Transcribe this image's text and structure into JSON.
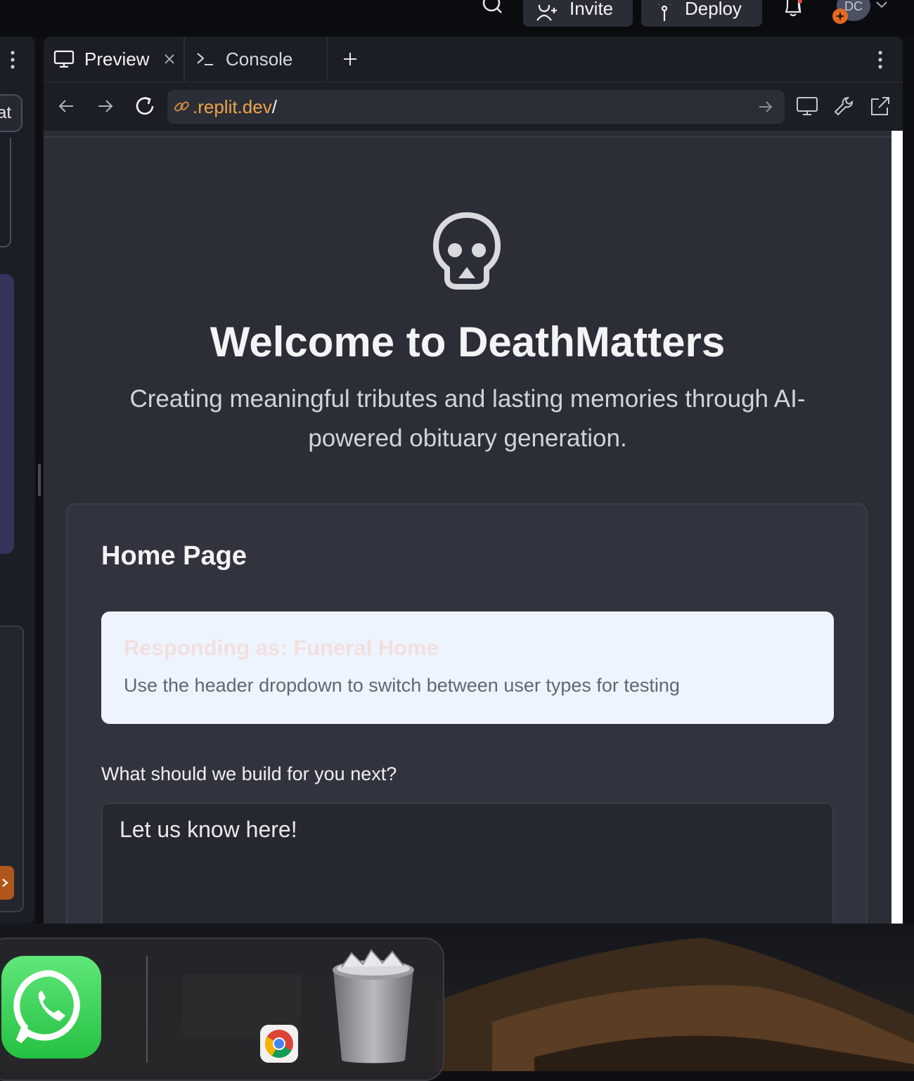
{
  "topbar": {
    "invite_label": "Invite",
    "deploy_label": "Deploy",
    "avatar_initials": "DC"
  },
  "left_panel": {
    "chat_partial": "at"
  },
  "tabs": [
    {
      "label": "Preview",
      "icon": "monitor-icon"
    },
    {
      "label": "Console",
      "icon": "terminal-icon"
    }
  ],
  "url": {
    "value_highlight": ".replit.dev",
    "value_suffix": "/"
  },
  "page": {
    "logo_icon": "skull-icon",
    "title": "Welcome to DeathMatters",
    "subtitle": "Creating meaningful tributes and lasting memories through AI-powered obituary generation.",
    "card": {
      "heading": "Home Page",
      "notice_title": "Responding as: Funeral Home",
      "notice_body": "Use the header dropdown to switch between user types for testing",
      "question_label": "What should we build for you next?",
      "textarea_placeholder": "Let us know here!"
    }
  },
  "colors": {
    "accent_orange": "#f0a44b",
    "page_bg": "#2b2e37",
    "notice_bg": "#eef4fd"
  },
  "dock": {
    "apps": [
      "whatsapp-icon",
      "chrome-window",
      "chrome-icon",
      "trash-icon"
    ]
  }
}
